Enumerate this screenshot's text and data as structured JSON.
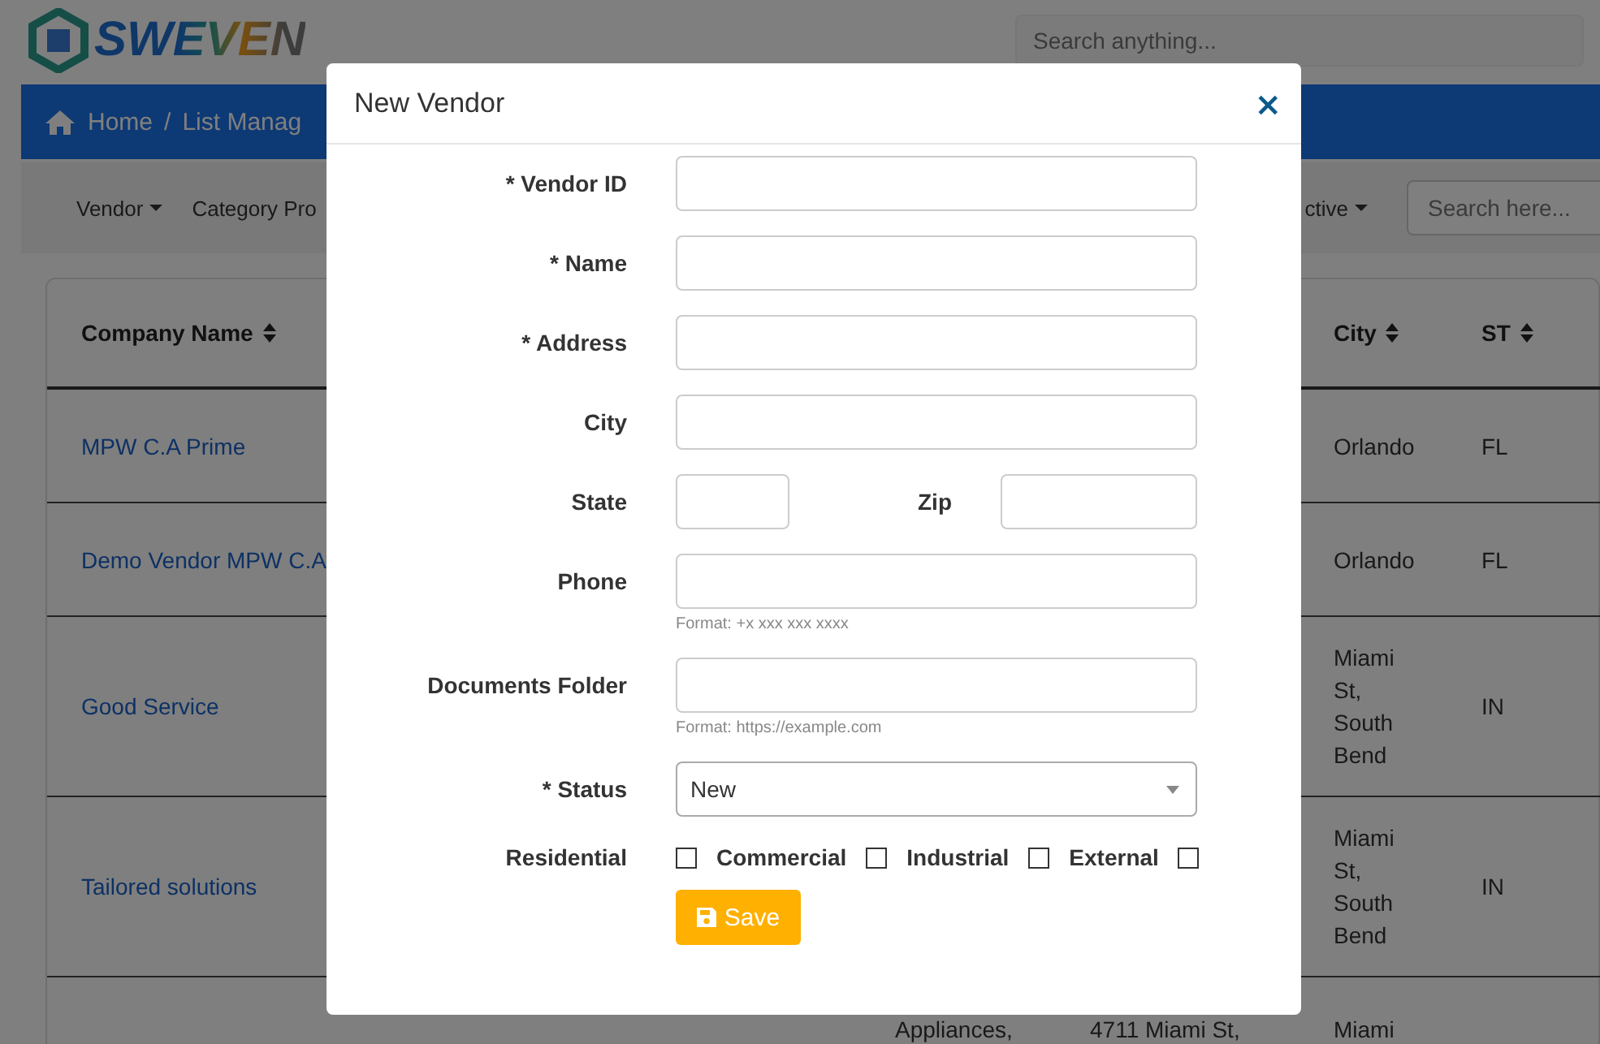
{
  "header": {
    "logo": "SWEVEN",
    "search_placeholder": "Search anything..."
  },
  "breadcrumb": {
    "items": [
      "Home",
      "List Manag"
    ],
    "separator": "/"
  },
  "toolbar": {
    "left": [
      {
        "label": "Vendor",
        "caret": true
      },
      {
        "label": "Category Pro",
        "caret": false
      }
    ],
    "right": [
      {
        "label": "ctive",
        "caret": true
      }
    ],
    "search_placeholder": "Search here..."
  },
  "table": {
    "columns": [
      {
        "label": "Company Name",
        "sort_icon": true
      },
      {
        "label": "City",
        "sort_icon": true
      },
      {
        "label": "ST",
        "sort_icon": true
      }
    ],
    "rows": [
      {
        "company": "MPW C.A Prime",
        "city": "Orlando",
        "st": "FL"
      },
      {
        "company": "Demo Vendor MPW C.A",
        "city": "Orlando",
        "st": "FL"
      },
      {
        "company": "Good Service",
        "city": "Miami St, South Bend",
        "st": "IN"
      },
      {
        "company": "Tailored solutions",
        "city": "Miami St, South Bend",
        "st": "IN"
      },
      {
        "column_2": "Appliances,",
        "column_3": "4711 Miami St,",
        "city": "Miami"
      }
    ]
  },
  "modal": {
    "title": "New Vendor",
    "close": "×",
    "fields": [
      {
        "kind": "text",
        "label": "* Vendor ID"
      },
      {
        "kind": "text",
        "label": "* Name"
      },
      {
        "kind": "text",
        "label": "* Address"
      },
      {
        "kind": "text",
        "label": "City"
      },
      {
        "kind": "pair",
        "items": [
          {
            "label": "State"
          },
          {
            "label": "Zip"
          }
        ]
      },
      {
        "kind": "text",
        "label": "Phone",
        "hint": "Format: +x xxx xxx xxxx"
      },
      {
        "kind": "text",
        "label": "Documents Folder",
        "hint": "Format: https://example.com"
      },
      {
        "kind": "select",
        "label": "* Status",
        "value": "New"
      },
      {
        "kind": "checkboxes",
        "items": [
          {
            "label": "Residential",
            "checked": false
          },
          {
            "label": "Commercial",
            "checked": false
          },
          {
            "label": "Industrial",
            "checked": false
          },
          {
            "label": "External",
            "checked": false
          }
        ]
      }
    ],
    "save": "Save"
  }
}
